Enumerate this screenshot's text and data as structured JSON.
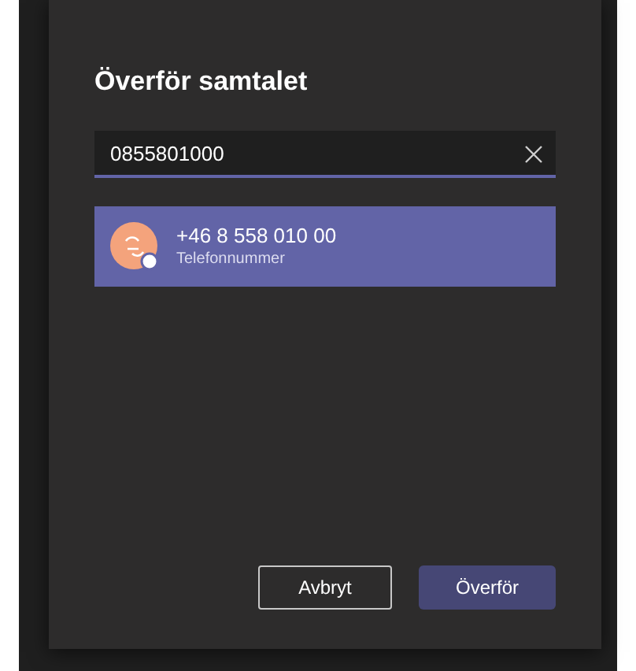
{
  "dialog": {
    "title": "Överför samtalet"
  },
  "search": {
    "value": "0855801000"
  },
  "results": [
    {
      "name": "+46 8 558 010 00",
      "subtitle": "Telefonnummer",
      "selected": true
    }
  ],
  "buttons": [
    {
      "label": "Avbryt",
      "kind": "secondary"
    },
    {
      "label": "Överför",
      "kind": "primary"
    }
  ]
}
